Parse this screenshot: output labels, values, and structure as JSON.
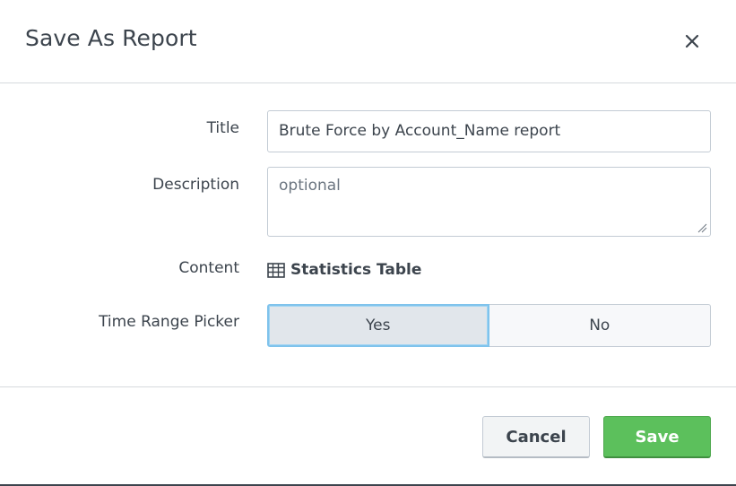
{
  "dialog": {
    "title": "Save As Report",
    "close_icon": "close-icon"
  },
  "form": {
    "title_label": "Title",
    "title_value": "Brute Force by Account_Name report",
    "description_label": "Description",
    "description_placeholder": "optional",
    "description_value": "",
    "content_label": "Content",
    "content_icon": "table-icon",
    "content_value": "Statistics Table",
    "time_range_label": "Time Range Picker",
    "time_range_options": [
      "Yes",
      "No"
    ],
    "time_range_selected": "Yes"
  },
  "footer": {
    "cancel_label": "Cancel",
    "save_label": "Save"
  },
  "colors": {
    "save_green": "#5cc05c",
    "focus_blue": "#7fc3ec",
    "text": "#3c444d"
  }
}
